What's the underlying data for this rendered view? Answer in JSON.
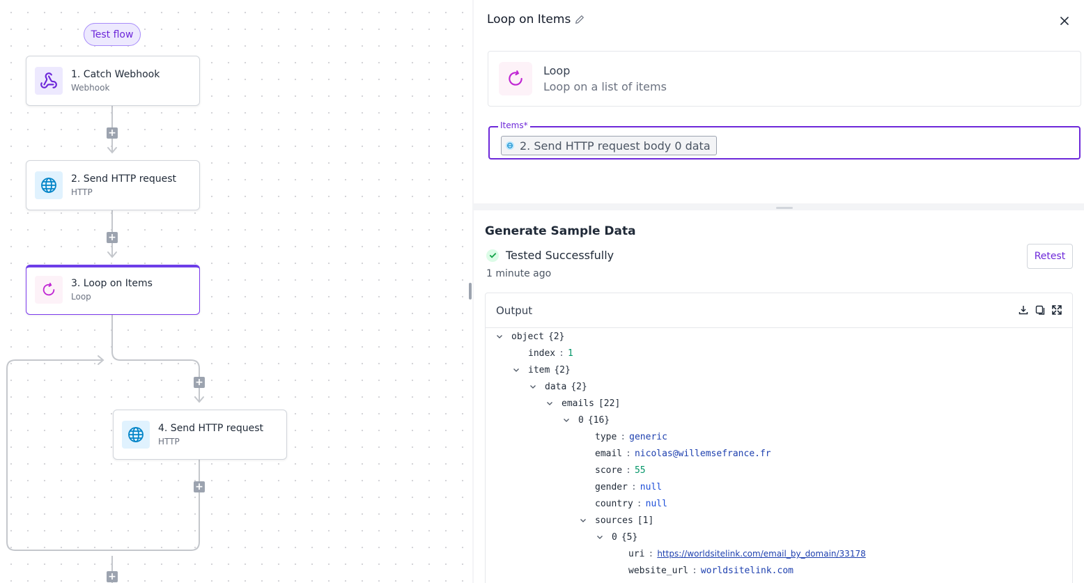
{
  "canvas": {
    "test_flow_label": "Test flow",
    "nodes": [
      {
        "title": "1. Catch Webhook",
        "subtitle": "Webhook",
        "icon": "webhook-icon"
      },
      {
        "title": "2. Send HTTP request",
        "subtitle": "HTTP",
        "icon": "globe-icon"
      },
      {
        "title": "3. Loop on Items",
        "subtitle": "Loop",
        "icon": "loop-icon"
      },
      {
        "title": "4. Send HTTP request",
        "subtitle": "HTTP",
        "icon": "globe-icon"
      }
    ],
    "plus_glyph": "+"
  },
  "panel": {
    "title": "Loop on Items",
    "piece": {
      "name": "Loop",
      "description": "Loop on a list of items"
    },
    "items_field": {
      "label": "Items*",
      "chip": "2. Send HTTP request body 0 data"
    },
    "sample": {
      "title": "Generate Sample Data",
      "status": "Tested Successfully",
      "time_ago": "1 minute ago",
      "retest_label": "Retest"
    },
    "output": {
      "title": "Output",
      "tree": [
        {
          "indent": 0,
          "caret": true,
          "key": "object",
          "meta": "{2}"
        },
        {
          "indent": 1,
          "caret": false,
          "key": "index",
          "value": "1",
          "vtype": "num"
        },
        {
          "indent": 1,
          "caret": true,
          "key": "item",
          "meta": "{2}"
        },
        {
          "indent": 2,
          "caret": true,
          "key": "data",
          "meta": "{2}"
        },
        {
          "indent": 3,
          "caret": true,
          "key": "emails",
          "meta": "[22]"
        },
        {
          "indent": 4,
          "caret": true,
          "key": "0",
          "meta": "{16}"
        },
        {
          "indent": 5,
          "caret": false,
          "key": "type",
          "value": "generic",
          "vtype": "str"
        },
        {
          "indent": 5,
          "caret": false,
          "key": "email",
          "value": "nicolas@willemsefrance.fr",
          "vtype": "str"
        },
        {
          "indent": 5,
          "caret": false,
          "key": "score",
          "value": "55",
          "vtype": "num"
        },
        {
          "indent": 5,
          "caret": false,
          "key": "gender",
          "value": "null",
          "vtype": "null"
        },
        {
          "indent": 5,
          "caret": false,
          "key": "country",
          "value": "null",
          "vtype": "null"
        },
        {
          "indent": 5,
          "caret": true,
          "key": "sources",
          "meta": "[1]"
        },
        {
          "indent": 6,
          "caret": true,
          "key": "0",
          "meta": "{5}"
        },
        {
          "indent": 7,
          "caret": false,
          "key": "uri",
          "value": "https://worldsitelink.com/email_by_domain/33178",
          "vtype": "link"
        },
        {
          "indent": 7,
          "caret": false,
          "key": "website_url",
          "value": "worldsitelink.com",
          "vtype": "str"
        }
      ]
    }
  },
  "colors": {
    "accent": "#6d28d9",
    "success": "#16a34a",
    "link": "#1e40af"
  }
}
